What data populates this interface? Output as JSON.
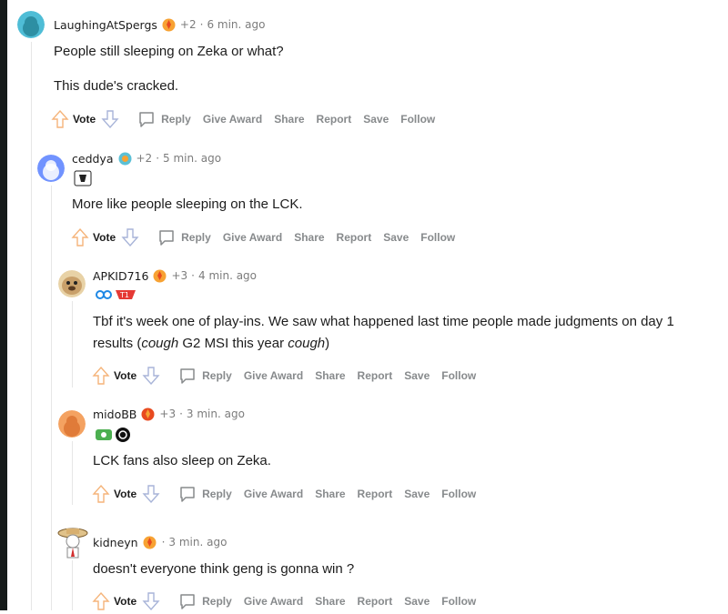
{
  "comments": [
    {
      "username": "LaughingAtSpergs",
      "score": "+2",
      "sep": "·",
      "time": "6 min. ago",
      "paragraphs": [
        "People still sleeping on Zeka or what?",
        "This dude's cracked."
      ],
      "avatar_color": "#24a0ed"
    },
    {
      "username": "ceddya",
      "score": "+2",
      "sep": "·",
      "time": "5 min. ago",
      "paragraphs": [
        "More like people sleeping on the LCK."
      ],
      "avatar_color": "#7193ff"
    },
    {
      "username": "APKID716",
      "score": "+3",
      "sep": "·",
      "time": "4 min. ago",
      "text_parts": [
        "Tbf it's week one of play-ins. We saw what happened last time people made judgments on day 1 results (",
        "cough",
        " G2 MSI this year ",
        "cough",
        ")"
      ],
      "avatar_color": "#d6b27a"
    },
    {
      "username": "midoBB",
      "score": "+3",
      "sep": "·",
      "time": "3 min. ago",
      "paragraphs": [
        "LCK fans also sleep on Zeka."
      ],
      "avatar_color": "#f4a261"
    },
    {
      "username": "kidneyn",
      "score": "",
      "sep": "·",
      "time": "3 min. ago",
      "paragraphs": [
        "doesn't everyone think geng is gonna win ?"
      ],
      "avatar_color": "#f1f1f1"
    }
  ],
  "actions": {
    "vote": "Vote",
    "reply": "Reply",
    "give_award": "Give Award",
    "share": "Share",
    "report": "Report",
    "save": "Save",
    "follow": "Follow"
  },
  "colors": {
    "upvote_outline": "#f5b47a",
    "downvote_outline": "#a8b4d8",
    "action_text": "#878a8c",
    "meta_text": "#7c7c7c",
    "thread_line": "#e6e6e6",
    "page_edge": "#161b1a"
  },
  "icons": {
    "upvote": "upvote-arrow-icon",
    "downvote": "downvote-arrow-icon",
    "reply": "speech-bubble-icon",
    "award": "award-flame-icon"
  }
}
